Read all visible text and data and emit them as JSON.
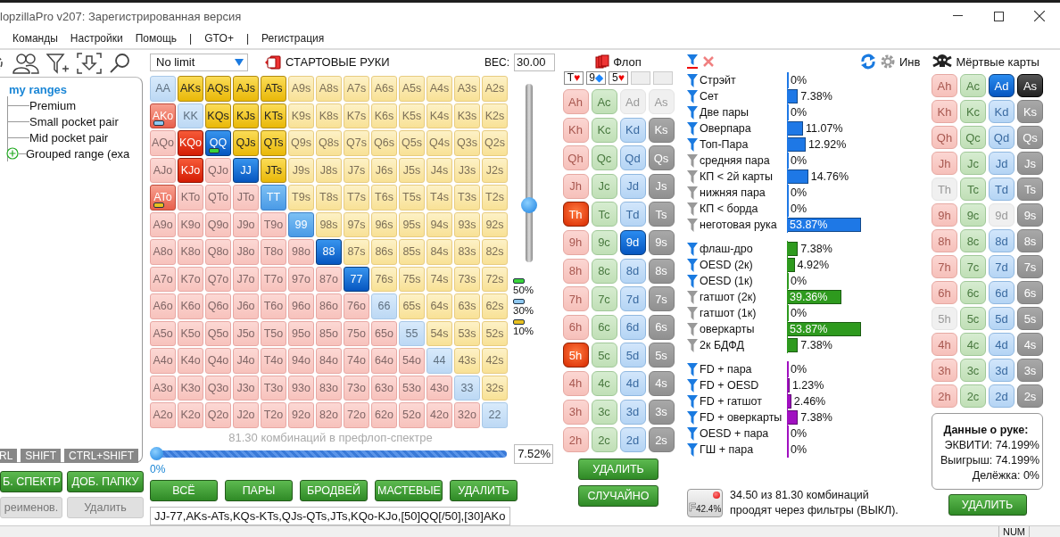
{
  "window": {
    "title": "lopzillaPro v207: Зарегистрированная версия"
  },
  "menu": [
    "Команды",
    "Настройки",
    "Помощь",
    "|",
    "GTO+",
    "|",
    "Регистрация"
  ],
  "tree": {
    "label": "my ranges",
    "children": [
      {
        "label": "Premium",
        "kind": "range"
      },
      {
        "label": "Small pocket pair",
        "kind": "range"
      },
      {
        "label": "Mid pocket pair",
        "kind": "range"
      },
      {
        "label": "Grouped range (exa",
        "kind": "group"
      }
    ]
  },
  "modifier_tabs": [
    "RL",
    "SHIFT",
    "CTRL+SHIFT"
  ],
  "left_buttons": [
    {
      "label": "Б. СПЕКТР",
      "disabled": false
    },
    {
      "label": "ДОБ. ПАПКУ",
      "disabled": false
    },
    {
      "label": "реименов.",
      "disabled": true
    },
    {
      "label": "Удалить",
      "disabled": true
    }
  ],
  "game_select": {
    "value": "No limit"
  },
  "section_title": "СТАРТОВЫЕ РУКИ",
  "weight": {
    "label": "ВЕС:",
    "value": "30.00"
  },
  "matrix": [
    [
      {
        "hand": "AA",
        "included": false,
        "weighted": false
      },
      {
        "hand": "AKs",
        "included": true,
        "weighted": false
      },
      {
        "hand": "AQs",
        "included": true,
        "weighted": false
      },
      {
        "hand": "AJs",
        "included": true,
        "weighted": false
      },
      {
        "hand": "ATs",
        "included": true,
        "weighted": false
      },
      {
        "hand": "A9s",
        "included": false,
        "weighted": false
      },
      {
        "hand": "A8s",
        "included": false,
        "weighted": false
      },
      {
        "hand": "A7s",
        "included": false,
        "weighted": false
      },
      {
        "hand": "A6s",
        "included": false,
        "weighted": false
      },
      {
        "hand": "A5s",
        "included": false,
        "weighted": false
      },
      {
        "hand": "A4s",
        "included": false,
        "weighted": false
      },
      {
        "hand": "A3s",
        "included": false,
        "weighted": false
      },
      {
        "hand": "A2s",
        "included": false,
        "weighted": false
      }
    ],
    [
      {
        "hand": "AKo",
        "included": true,
        "weighted": true,
        "color": "#8fc8f0"
      },
      {
        "hand": "KK",
        "included": false,
        "weighted": false
      },
      {
        "hand": "KQs",
        "included": true,
        "weighted": false
      },
      {
        "hand": "KJs",
        "included": true,
        "weighted": false
      },
      {
        "hand": "KTs",
        "included": true,
        "weighted": false
      },
      {
        "hand": "K9s",
        "included": false,
        "weighted": false
      },
      {
        "hand": "K8s",
        "included": false,
        "weighted": false
      },
      {
        "hand": "K7s",
        "included": false,
        "weighted": false
      },
      {
        "hand": "K6s",
        "included": false,
        "weighted": false
      },
      {
        "hand": "K5s",
        "included": false,
        "weighted": false
      },
      {
        "hand": "K4s",
        "included": false,
        "weighted": false
      },
      {
        "hand": "K3s",
        "included": false,
        "weighted": false
      },
      {
        "hand": "K2s",
        "included": false,
        "weighted": false
      }
    ],
    [
      {
        "hand": "AQo",
        "included": false,
        "weighted": false
      },
      {
        "hand": "KQo",
        "included": true,
        "weighted": false
      },
      {
        "hand": "QQ",
        "included": true,
        "weighted": false,
        "color": "#3ad43a"
      },
      {
        "hand": "QJs",
        "included": true,
        "weighted": false
      },
      {
        "hand": "QTs",
        "included": true,
        "weighted": false
      },
      {
        "hand": "Q9s",
        "included": false,
        "weighted": false
      },
      {
        "hand": "Q8s",
        "included": false,
        "weighted": false
      },
      {
        "hand": "Q7s",
        "included": false,
        "weighted": false
      },
      {
        "hand": "Q6s",
        "included": false,
        "weighted": false
      },
      {
        "hand": "Q5s",
        "included": false,
        "weighted": false
      },
      {
        "hand": "Q4s",
        "included": false,
        "weighted": false
      },
      {
        "hand": "Q3s",
        "included": false,
        "weighted": false
      },
      {
        "hand": "Q2s",
        "included": false,
        "weighted": false
      }
    ],
    [
      {
        "hand": "AJo",
        "included": false,
        "weighted": false
      },
      {
        "hand": "KJo",
        "included": true,
        "weighted": false
      },
      {
        "hand": "QJo",
        "included": false,
        "weighted": false
      },
      {
        "hand": "JJ",
        "included": true,
        "weighted": false
      },
      {
        "hand": "JTs",
        "included": true,
        "weighted": false
      },
      {
        "hand": "J9s",
        "included": false,
        "weighted": false
      },
      {
        "hand": "J8s",
        "included": false,
        "weighted": false
      },
      {
        "hand": "J7s",
        "included": false,
        "weighted": false
      },
      {
        "hand": "J6s",
        "included": false,
        "weighted": false
      },
      {
        "hand": "J5s",
        "included": false,
        "weighted": false
      },
      {
        "hand": "J4s",
        "included": false,
        "weighted": false
      },
      {
        "hand": "J3s",
        "included": false,
        "weighted": false
      },
      {
        "hand": "J2s",
        "included": false,
        "weighted": false
      }
    ],
    [
      {
        "hand": "ATo",
        "included": true,
        "weighted": true,
        "color": "#e8c020"
      },
      {
        "hand": "KTo",
        "included": false,
        "weighted": false
      },
      {
        "hand": "QTo",
        "included": false,
        "weighted": false
      },
      {
        "hand": "JTo",
        "included": false,
        "weighted": false
      },
      {
        "hand": "TT",
        "included": true,
        "weighted": true
      },
      {
        "hand": "T9s",
        "included": false,
        "weighted": false
      },
      {
        "hand": "T8s",
        "included": false,
        "weighted": false
      },
      {
        "hand": "T7s",
        "included": false,
        "weighted": false
      },
      {
        "hand": "T6s",
        "included": false,
        "weighted": false
      },
      {
        "hand": "T5s",
        "included": false,
        "weighted": false
      },
      {
        "hand": "T4s",
        "included": false,
        "weighted": false
      },
      {
        "hand": "T3s",
        "included": false,
        "weighted": false
      },
      {
        "hand": "T2s",
        "included": false,
        "weighted": false
      }
    ],
    [
      {
        "hand": "A9o",
        "included": false,
        "weighted": false
      },
      {
        "hand": "K9o",
        "included": false,
        "weighted": false
      },
      {
        "hand": "Q9o",
        "included": false,
        "weighted": false
      },
      {
        "hand": "J9o",
        "included": false,
        "weighted": false
      },
      {
        "hand": "T9o",
        "included": false,
        "weighted": false
      },
      {
        "hand": "99",
        "included": true,
        "weighted": true
      },
      {
        "hand": "98s",
        "included": false,
        "weighted": false
      },
      {
        "hand": "97s",
        "included": false,
        "weighted": false
      },
      {
        "hand": "96s",
        "included": false,
        "weighted": false
      },
      {
        "hand": "95s",
        "included": false,
        "weighted": false
      },
      {
        "hand": "94s",
        "included": false,
        "weighted": false
      },
      {
        "hand": "93s",
        "included": false,
        "weighted": false
      },
      {
        "hand": "92s",
        "included": false,
        "weighted": false
      }
    ],
    [
      {
        "hand": "A8o",
        "included": false,
        "weighted": false
      },
      {
        "hand": "K8o",
        "included": false,
        "weighted": false
      },
      {
        "hand": "Q8o",
        "included": false,
        "weighted": false
      },
      {
        "hand": "J8o",
        "included": false,
        "weighted": false
      },
      {
        "hand": "T8o",
        "included": false,
        "weighted": false
      },
      {
        "hand": "98o",
        "included": false,
        "weighted": false
      },
      {
        "hand": "88",
        "included": true,
        "weighted": false
      },
      {
        "hand": "87s",
        "included": false,
        "weighted": false
      },
      {
        "hand": "86s",
        "included": false,
        "weighted": false
      },
      {
        "hand": "85s",
        "included": false,
        "weighted": false
      },
      {
        "hand": "84s",
        "included": false,
        "weighted": false
      },
      {
        "hand": "83s",
        "included": false,
        "weighted": false
      },
      {
        "hand": "82s",
        "included": false,
        "weighted": false
      }
    ],
    [
      {
        "hand": "A7o",
        "included": false,
        "weighted": false
      },
      {
        "hand": "K7o",
        "included": false,
        "weighted": false
      },
      {
        "hand": "Q7o",
        "included": false,
        "weighted": false
      },
      {
        "hand": "J7o",
        "included": false,
        "weighted": false
      },
      {
        "hand": "T7o",
        "included": false,
        "weighted": false
      },
      {
        "hand": "97o",
        "included": false,
        "weighted": false
      },
      {
        "hand": "87o",
        "included": false,
        "weighted": false
      },
      {
        "hand": "77",
        "included": true,
        "weighted": false
      },
      {
        "hand": "76s",
        "included": false,
        "weighted": false
      },
      {
        "hand": "75s",
        "included": false,
        "weighted": false
      },
      {
        "hand": "74s",
        "included": false,
        "weighted": false
      },
      {
        "hand": "73s",
        "included": false,
        "weighted": false
      },
      {
        "hand": "72s",
        "included": false,
        "weighted": false
      }
    ],
    [
      {
        "hand": "A6o",
        "included": false,
        "weighted": false
      },
      {
        "hand": "K6o",
        "included": false,
        "weighted": false
      },
      {
        "hand": "Q6o",
        "included": false,
        "weighted": false
      },
      {
        "hand": "J6o",
        "included": false,
        "weighted": false
      },
      {
        "hand": "T6o",
        "included": false,
        "weighted": false
      },
      {
        "hand": "96o",
        "included": false,
        "weighted": false
      },
      {
        "hand": "86o",
        "included": false,
        "weighted": false
      },
      {
        "hand": "76o",
        "included": false,
        "weighted": false
      },
      {
        "hand": "66",
        "included": false,
        "weighted": false
      },
      {
        "hand": "65s",
        "included": false,
        "weighted": false
      },
      {
        "hand": "64s",
        "included": false,
        "weighted": false
      },
      {
        "hand": "63s",
        "included": false,
        "weighted": false
      },
      {
        "hand": "62s",
        "included": false,
        "weighted": false
      }
    ],
    [
      {
        "hand": "A5o",
        "included": false,
        "weighted": false
      },
      {
        "hand": "K5o",
        "included": false,
        "weighted": false
      },
      {
        "hand": "Q5o",
        "included": false,
        "weighted": false
      },
      {
        "hand": "J5o",
        "included": false,
        "weighted": false
      },
      {
        "hand": "T5o",
        "included": false,
        "weighted": false
      },
      {
        "hand": "95o",
        "included": false,
        "weighted": false
      },
      {
        "hand": "85o",
        "included": false,
        "weighted": false
      },
      {
        "hand": "75o",
        "included": false,
        "weighted": false
      },
      {
        "hand": "65o",
        "included": false,
        "weighted": false
      },
      {
        "hand": "55",
        "included": false,
        "weighted": false
      },
      {
        "hand": "54s",
        "included": false,
        "weighted": false
      },
      {
        "hand": "53s",
        "included": false,
        "weighted": false
      },
      {
        "hand": "52s",
        "included": false,
        "weighted": false
      }
    ],
    [
      {
        "hand": "A4o",
        "included": false,
        "weighted": false
      },
      {
        "hand": "K4o",
        "included": false,
        "weighted": false
      },
      {
        "hand": "Q4o",
        "included": false,
        "weighted": false
      },
      {
        "hand": "J4o",
        "included": false,
        "weighted": false
      },
      {
        "hand": "T4o",
        "included": false,
        "weighted": false
      },
      {
        "hand": "94o",
        "included": false,
        "weighted": false
      },
      {
        "hand": "84o",
        "included": false,
        "weighted": false
      },
      {
        "hand": "74o",
        "included": false,
        "weighted": false
      },
      {
        "hand": "64o",
        "included": false,
        "weighted": false
      },
      {
        "hand": "54o",
        "included": false,
        "weighted": false
      },
      {
        "hand": "44",
        "included": false,
        "weighted": false
      },
      {
        "hand": "43s",
        "included": false,
        "weighted": false
      },
      {
        "hand": "42s",
        "included": false,
        "weighted": false
      }
    ],
    [
      {
        "hand": "A3o",
        "included": false,
        "weighted": false
      },
      {
        "hand": "K3o",
        "included": false,
        "weighted": false
      },
      {
        "hand": "Q3o",
        "included": false,
        "weighted": false
      },
      {
        "hand": "J3o",
        "included": false,
        "weighted": false
      },
      {
        "hand": "T3o",
        "included": false,
        "weighted": false
      },
      {
        "hand": "93o",
        "included": false,
        "weighted": false
      },
      {
        "hand": "83o",
        "included": false,
        "weighted": false
      },
      {
        "hand": "73o",
        "included": false,
        "weighted": false
      },
      {
        "hand": "63o",
        "included": false,
        "weighted": false
      },
      {
        "hand": "53o",
        "included": false,
        "weighted": false
      },
      {
        "hand": "43o",
        "included": false,
        "weighted": false
      },
      {
        "hand": "33",
        "included": false,
        "weighted": false
      },
      {
        "hand": "32s",
        "included": false,
        "weighted": false
      }
    ],
    [
      {
        "hand": "A2o",
        "included": false,
        "weighted": false
      },
      {
        "hand": "K2o",
        "included": false,
        "weighted": false
      },
      {
        "hand": "Q2o",
        "included": false,
        "weighted": false
      },
      {
        "hand": "J2o",
        "included": false,
        "weighted": false
      },
      {
        "hand": "T2o",
        "included": false,
        "weighted": false
      },
      {
        "hand": "92o",
        "included": false,
        "weighted": false
      },
      {
        "hand": "82o",
        "included": false,
        "weighted": false
      },
      {
        "hand": "72o",
        "included": false,
        "weighted": false
      },
      {
        "hand": "62o",
        "included": false,
        "weighted": false
      },
      {
        "hand": "52o",
        "included": false,
        "weighted": false
      },
      {
        "hand": "42o",
        "included": false,
        "weighted": false
      },
      {
        "hand": "32o",
        "included": false,
        "weighted": false
      },
      {
        "hand": "22",
        "included": false,
        "weighted": false
      }
    ]
  ],
  "weight_slider": {
    "level": 0.32
  },
  "legend": [
    {
      "label": "50%",
      "color": "#3ad43a"
    },
    {
      "label": "30%",
      "color": "#8fc8f0"
    },
    {
      "label": "10%",
      "color": "#e8c020"
    }
  ],
  "combos_caption": "81.30 комбинаций в префлоп-спектре",
  "range_slider": {
    "level": 0,
    "min_label": "0%",
    "value": "7.52%"
  },
  "action_buttons": [
    "ВСЁ",
    "ПАРЫ",
    "БРОДВЕЙ",
    "МАСТЕВЫЕ",
    "УДАЛИТЬ"
  ],
  "range_text": "JJ-77,AKs-ATs,KQs-KTs,QJs-QTs,JTs,KQo-KJo,[50]QQ[/50],[30]AKo",
  "flop": {
    "title": "Флоп",
    "slots": [
      {
        "filled": true,
        "rank": "T",
        "symbol": "♥",
        "color": "#ee0000"
      },
      {
        "filled": true,
        "rank": "9",
        "symbol": "◆",
        "color": "#1a86ff"
      },
      {
        "filled": true,
        "rank": "5",
        "symbol": "♥",
        "color": "#ee0000"
      },
      {
        "filled": false
      },
      {
        "filled": false
      }
    ],
    "cards": [
      [
        {
          "card": "Ah",
          "selected": false,
          "disabled": false
        },
        {
          "card": "Ac",
          "selected": false,
          "disabled": false
        },
        {
          "card": "Ad",
          "selected": false,
          "disabled": true
        },
        {
          "card": "As",
          "selected": false,
          "disabled": true
        }
      ],
      [
        {
          "card": "Kh",
          "selected": false,
          "disabled": false
        },
        {
          "card": "Kc",
          "selected": false,
          "disabled": false
        },
        {
          "card": "Kd",
          "selected": false,
          "disabled": false
        },
        {
          "card": "Ks",
          "selected": false,
          "disabled": false
        }
      ],
      [
        {
          "card": "Qh",
          "selected": false,
          "disabled": false
        },
        {
          "card": "Qc",
          "selected": false,
          "disabled": false
        },
        {
          "card": "Qd",
          "selected": false,
          "disabled": false
        },
        {
          "card": "Qs",
          "selected": false,
          "disabled": false
        }
      ],
      [
        {
          "card": "Jh",
          "selected": false,
          "disabled": false
        },
        {
          "card": "Jc",
          "selected": false,
          "disabled": false
        },
        {
          "card": "Jd",
          "selected": false,
          "disabled": false
        },
        {
          "card": "Js",
          "selected": false,
          "disabled": false
        }
      ],
      [
        {
          "card": "Th",
          "selected": true,
          "disabled": false
        },
        {
          "card": "Tc",
          "selected": false,
          "disabled": false
        },
        {
          "card": "Td",
          "selected": false,
          "disabled": false
        },
        {
          "card": "Ts",
          "selected": false,
          "disabled": false
        }
      ],
      [
        {
          "card": "9h",
          "selected": false,
          "disabled": false
        },
        {
          "card": "9c",
          "selected": false,
          "disabled": false
        },
        {
          "card": "9d",
          "selected": true,
          "disabled": false
        },
        {
          "card": "9s",
          "selected": false,
          "disabled": false
        }
      ],
      [
        {
          "card": "8h",
          "selected": false,
          "disabled": false
        },
        {
          "card": "8c",
          "selected": false,
          "disabled": false
        },
        {
          "card": "8d",
          "selected": false,
          "disabled": false
        },
        {
          "card": "8s",
          "selected": false,
          "disabled": false
        }
      ],
      [
        {
          "card": "7h",
          "selected": false,
          "disabled": false
        },
        {
          "card": "7c",
          "selected": false,
          "disabled": false
        },
        {
          "card": "7d",
          "selected": false,
          "disabled": false
        },
        {
          "card": "7s",
          "selected": false,
          "disabled": false
        }
      ],
      [
        {
          "card": "6h",
          "selected": false,
          "disabled": false
        },
        {
          "card": "6c",
          "selected": false,
          "disabled": false
        },
        {
          "card": "6d",
          "selected": false,
          "disabled": false
        },
        {
          "card": "6s",
          "selected": false,
          "disabled": false
        }
      ],
      [
        {
          "card": "5h",
          "selected": true,
          "disabled": false
        },
        {
          "card": "5c",
          "selected": false,
          "disabled": false
        },
        {
          "card": "5d",
          "selected": false,
          "disabled": false
        },
        {
          "card": "5s",
          "selected": false,
          "disabled": false
        }
      ],
      [
        {
          "card": "4h",
          "selected": false,
          "disabled": false
        },
        {
          "card": "4c",
          "selected": false,
          "disabled": false
        },
        {
          "card": "4d",
          "selected": false,
          "disabled": false
        },
        {
          "card": "4s",
          "selected": false,
          "disabled": false
        }
      ],
      [
        {
          "card": "3h",
          "selected": false,
          "disabled": false
        },
        {
          "card": "3c",
          "selected": false,
          "disabled": false
        },
        {
          "card": "3d",
          "selected": false,
          "disabled": false
        },
        {
          "card": "3s",
          "selected": false,
          "disabled": false
        }
      ],
      [
        {
          "card": "2h",
          "selected": false,
          "disabled": false
        },
        {
          "card": "2c",
          "selected": false,
          "disabled": false
        },
        {
          "card": "2d",
          "selected": false,
          "disabled": false
        },
        {
          "card": "2s",
          "selected": false,
          "disabled": false
        }
      ]
    ],
    "buttons": [
      "УДАЛИТЬ",
      "СЛУЧАЙНО"
    ]
  },
  "filter_groups": [
    {
      "color": "#1e78e6",
      "items": [
        {
          "label": "Стрэйт",
          "active": true,
          "level": 0,
          "reading": "0%"
        },
        {
          "label": "Сет",
          "active": true,
          "level": 0.0738,
          "reading": "7.38%"
        },
        {
          "label": "Две пары",
          "active": true,
          "level": 0,
          "reading": "0%"
        },
        {
          "label": "Оверпара",
          "active": true,
          "level": 0.1107,
          "reading": "11.07%"
        },
        {
          "label": "Топ-Пара",
          "active": true,
          "level": 0.1292,
          "reading": "12.92%"
        },
        {
          "label": "средняя пара",
          "active": false,
          "level": 0,
          "reading": "0%"
        },
        {
          "label": "КП < 2й карты",
          "active": false,
          "level": 0.1476,
          "reading": "14.76%"
        },
        {
          "label": "нижняя пара",
          "active": false,
          "level": 0,
          "reading": "0%"
        },
        {
          "label": "КП < борда",
          "active": false,
          "level": 0,
          "reading": "0%"
        },
        {
          "label": "неготовая рука",
          "active": false,
          "level": 0.5387,
          "reading": "53.87%"
        }
      ]
    },
    {
      "color": "#2e9a1e",
      "items": [
        {
          "label": "флаш-дро",
          "active": true,
          "level": 0.0738,
          "reading": "7.38%"
        },
        {
          "label": "OESD (2к)",
          "active": true,
          "level": 0.0492,
          "reading": "4.92%"
        },
        {
          "label": "OESD (1к)",
          "active": true,
          "level": 0,
          "reading": "0%"
        },
        {
          "label": "гатшот (2к)",
          "active": false,
          "level": 0.3936,
          "reading": "39.36%"
        },
        {
          "label": "гатшот (1к)",
          "active": false,
          "level": 0,
          "reading": "0%"
        },
        {
          "label": "оверкарты",
          "active": false,
          "level": 0.5387,
          "reading": "53.87%"
        },
        {
          "label": "2к БДФД",
          "active": false,
          "level": 0.0738,
          "reading": "7.38%"
        }
      ]
    },
    {
      "color": "#a010c0",
      "items": [
        {
          "label": "FD + пара",
          "active": true,
          "level": 0,
          "reading": "0%"
        },
        {
          "label": "FD + OESD",
          "active": true,
          "level": 0.0123,
          "reading": "1.23%"
        },
        {
          "label": "FD + гатшот",
          "active": true,
          "level": 0.0246,
          "reading": "2.46%"
        },
        {
          "label": "FD + оверкарты",
          "active": true,
          "level": 0.0738,
          "reading": "7.38%"
        },
        {
          "label": "OESD + пара",
          "active": true,
          "level": 0,
          "reading": "0%"
        },
        {
          "label": "ГШ + пара",
          "active": true,
          "level": 0,
          "reading": "0%"
        }
      ]
    }
  ],
  "filter_toggle": {
    "letter": "F",
    "value": "42.4%"
  },
  "filter_summary": "34.50 из 81.30 комбинаций проодят через фильтры (ВЫКЛ).",
  "invert_label": "Инв",
  "dead_cards": {
    "title": "Мёртвые карты",
    "cards": [
      [
        {
          "card": "Ah",
          "selected": false,
          "disabled": false
        },
        {
          "card": "Ac",
          "selected": false,
          "disabled": false
        },
        {
          "card": "Ad",
          "selected": true,
          "disabled": false
        },
        {
          "card": "As",
          "selected": true,
          "disabled": false
        }
      ],
      [
        {
          "card": "Kh",
          "selected": false,
          "disabled": false
        },
        {
          "card": "Kc",
          "selected": false,
          "disabled": false
        },
        {
          "card": "Kd",
          "selected": false,
          "disabled": false
        },
        {
          "card": "Ks",
          "selected": false,
          "disabled": false
        }
      ],
      [
        {
          "card": "Qh",
          "selected": false,
          "disabled": false
        },
        {
          "card": "Qc",
          "selected": false,
          "disabled": false
        },
        {
          "card": "Qd",
          "selected": false,
          "disabled": false
        },
        {
          "card": "Qs",
          "selected": false,
          "disabled": false
        }
      ],
      [
        {
          "card": "Jh",
          "selected": false,
          "disabled": false
        },
        {
          "card": "Jc",
          "selected": false,
          "disabled": false
        },
        {
          "card": "Jd",
          "selected": false,
          "disabled": false
        },
        {
          "card": "Js",
          "selected": false,
          "disabled": false
        }
      ],
      [
        {
          "card": "Th",
          "selected": false,
          "disabled": true
        },
        {
          "card": "Tc",
          "selected": false,
          "disabled": false
        },
        {
          "card": "Td",
          "selected": false,
          "disabled": false
        },
        {
          "card": "Ts",
          "selected": false,
          "disabled": false
        }
      ],
      [
        {
          "card": "9h",
          "selected": false,
          "disabled": false
        },
        {
          "card": "9c",
          "selected": false,
          "disabled": false
        },
        {
          "card": "9d",
          "selected": false,
          "disabled": true
        },
        {
          "card": "9s",
          "selected": false,
          "disabled": false
        }
      ],
      [
        {
          "card": "8h",
          "selected": false,
          "disabled": false
        },
        {
          "card": "8c",
          "selected": false,
          "disabled": false
        },
        {
          "card": "8d",
          "selected": false,
          "disabled": false
        },
        {
          "card": "8s",
          "selected": false,
          "disabled": false
        }
      ],
      [
        {
          "card": "7h",
          "selected": false,
          "disabled": false
        },
        {
          "card": "7c",
          "selected": false,
          "disabled": false
        },
        {
          "card": "7d",
          "selected": false,
          "disabled": false
        },
        {
          "card": "7s",
          "selected": false,
          "disabled": false
        }
      ],
      [
        {
          "card": "6h",
          "selected": false,
          "disabled": false
        },
        {
          "card": "6c",
          "selected": false,
          "disabled": false
        },
        {
          "card": "6d",
          "selected": false,
          "disabled": false
        },
        {
          "card": "6s",
          "selected": false,
          "disabled": false
        }
      ],
      [
        {
          "card": "5h",
          "selected": false,
          "disabled": true
        },
        {
          "card": "5c",
          "selected": false,
          "disabled": false
        },
        {
          "card": "5d",
          "selected": false,
          "disabled": false
        },
        {
          "card": "5s",
          "selected": false,
          "disabled": false
        }
      ],
      [
        {
          "card": "4h",
          "selected": false,
          "disabled": false
        },
        {
          "card": "4c",
          "selected": false,
          "disabled": false
        },
        {
          "card": "4d",
          "selected": false,
          "disabled": false
        },
        {
          "card": "4s",
          "selected": false,
          "disabled": false
        }
      ],
      [
        {
          "card": "3h",
          "selected": false,
          "disabled": false
        },
        {
          "card": "3c",
          "selected": false,
          "disabled": false
        },
        {
          "card": "3d",
          "selected": false,
          "disabled": false
        },
        {
          "card": "3s",
          "selected": false,
          "disabled": false
        }
      ],
      [
        {
          "card": "2h",
          "selected": false,
          "disabled": false
        },
        {
          "card": "2c",
          "selected": false,
          "disabled": false
        },
        {
          "card": "2d",
          "selected": false,
          "disabled": false
        },
        {
          "card": "2s",
          "selected": false,
          "disabled": false
        }
      ]
    ]
  },
  "hand_info": {
    "title": "Данные о руке:",
    "lines": [
      "ЭКВИТИ: 74.199%",
      "Выигрыш: 74.199%",
      "Делёжка: 0%"
    ]
  },
  "right_button": "УДАЛИТЬ",
  "status_bar": {
    "indicator": "NUM"
  }
}
